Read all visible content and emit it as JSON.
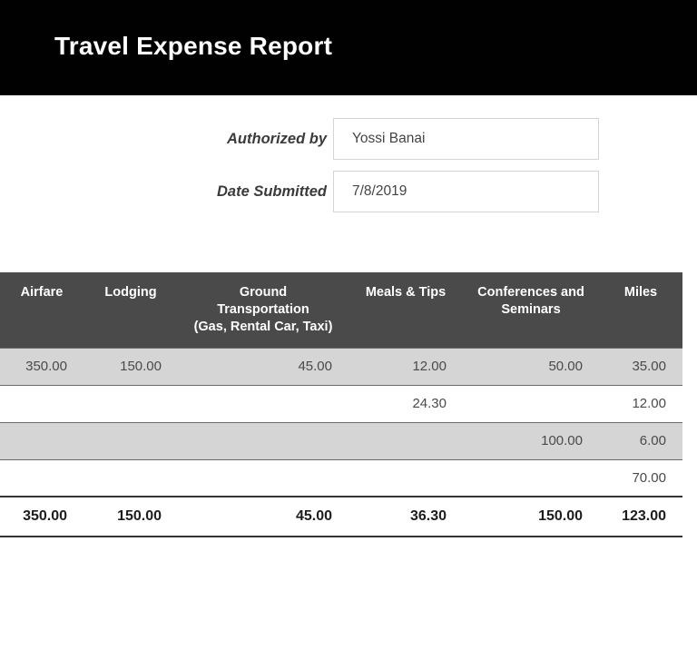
{
  "header": {
    "title": "Travel Expense Report",
    "background_color": "#010101",
    "text_color": "#ffffff"
  },
  "form": {
    "authorized_by": {
      "label": "Authorized by",
      "value": "Yossi Banai",
      "placeholder": ""
    },
    "date_submitted": {
      "label": "Date Submitted",
      "value": "7/8/2019",
      "placeholder": ""
    }
  },
  "table": {
    "header_background": "#4a4a4a",
    "shaded_row_background": "#d5d5d5",
    "columns": [
      {
        "key": "airfare",
        "label": "Airfare"
      },
      {
        "key": "lodging",
        "label": "Lodging"
      },
      {
        "key": "ground",
        "label": "Ground Transportation (Gas, Rental Car, Taxi)"
      },
      {
        "key": "meals",
        "label": "Meals & Tips"
      },
      {
        "key": "conferences",
        "label": "Conferences and Seminars"
      },
      {
        "key": "miles",
        "label": "Miles"
      }
    ],
    "column_labels": {
      "airfare": "Airfare",
      "lodging": "Lodging",
      "ground_line1": "Ground",
      "ground_line2": "Transportation",
      "ground_line3": "(Gas, Rental Car, Taxi)",
      "meals": "Meals & Tips",
      "conferences_line1": "Conferences and",
      "conferences_line2": "Seminars",
      "miles": "Miles"
    },
    "rows": [
      {
        "shaded": true,
        "airfare": "350.00",
        "lodging": "150.00",
        "ground": "45.00",
        "meals": "12.00",
        "conferences": "50.00",
        "miles": "35.00"
      },
      {
        "shaded": false,
        "airfare": "",
        "lodging": "",
        "ground": "",
        "meals": "24.30",
        "conferences": "",
        "miles": "12.00"
      },
      {
        "shaded": true,
        "airfare": "",
        "lodging": "",
        "ground": "",
        "meals": "",
        "conferences": "100.00",
        "miles": "6.00"
      },
      {
        "shaded": false,
        "airfare": "",
        "lodging": "",
        "ground": "",
        "meals": "",
        "conferences": "",
        "miles": "70.00"
      }
    ],
    "total_row": {
      "airfare": "350.00",
      "lodging": "150.00",
      "ground": "45.00",
      "meals": "36.30",
      "conferences": "150.00",
      "miles": "123.00"
    }
  }
}
